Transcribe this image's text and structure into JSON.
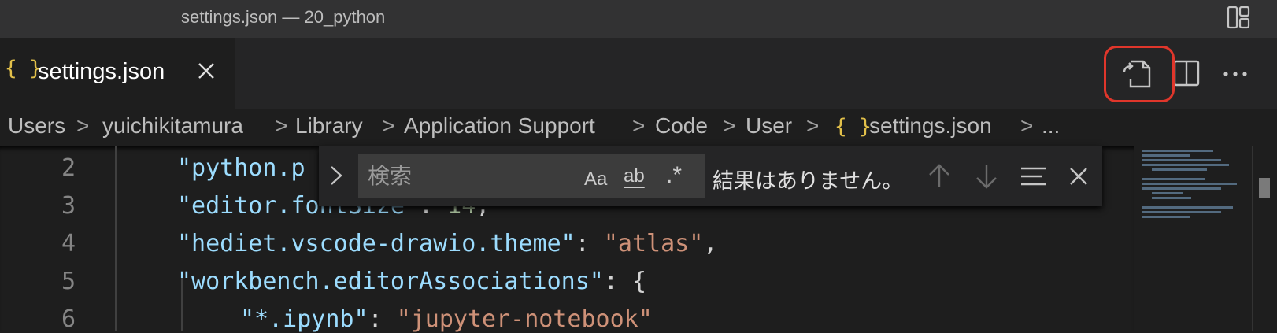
{
  "window": {
    "title": "settings.json — 20_python"
  },
  "tab": {
    "icon_glyph": "{ }",
    "label": "settings.json",
    "close_icon": "close-icon"
  },
  "toolbar": {
    "open_json_icon": "open-settings-json-icon",
    "split_icon": "split-editor-icon",
    "more_icon": "more-actions-icon",
    "layout_icon": "customize-layout-icon"
  },
  "breadcrumb": {
    "items": [
      "Users",
      "yuichikitamura",
      "Library",
      "Application Support",
      "Code",
      "User",
      "settings.json",
      "..."
    ],
    "separator": ">",
    "file_icon_glyph": "{ }"
  },
  "editor": {
    "lines": [
      {
        "num": "2",
        "key": "\"python.p",
        "after": ""
      },
      {
        "num": "3",
        "key": "\"editor.fontSize\"",
        "colon": ": ",
        "value": "14",
        "end": ","
      },
      {
        "num": "4",
        "key": "\"hediet.vscode-drawio.theme\"",
        "colon": ": ",
        "value": "\"atlas\"",
        "end": ","
      },
      {
        "num": "5",
        "key": "\"workbench.editorAssociations\"",
        "colon": ": ",
        "value": "{",
        "end": ""
      },
      {
        "num": "6",
        "key": "\"*.ipynb\"",
        "colon": ": ",
        "value": "\"jupyter-notebook\"",
        "end": ""
      }
    ]
  },
  "find": {
    "placeholder": "検索",
    "match_case": "Aa",
    "whole_word": "ab",
    "regex": ".*",
    "status": "結果はありません。"
  },
  "colors": {
    "accent_highlight": "#e0362b",
    "json_icon": "#e2c04a",
    "key": "#9cdcfe",
    "string": "#ce9178",
    "number": "#b5cea8"
  }
}
